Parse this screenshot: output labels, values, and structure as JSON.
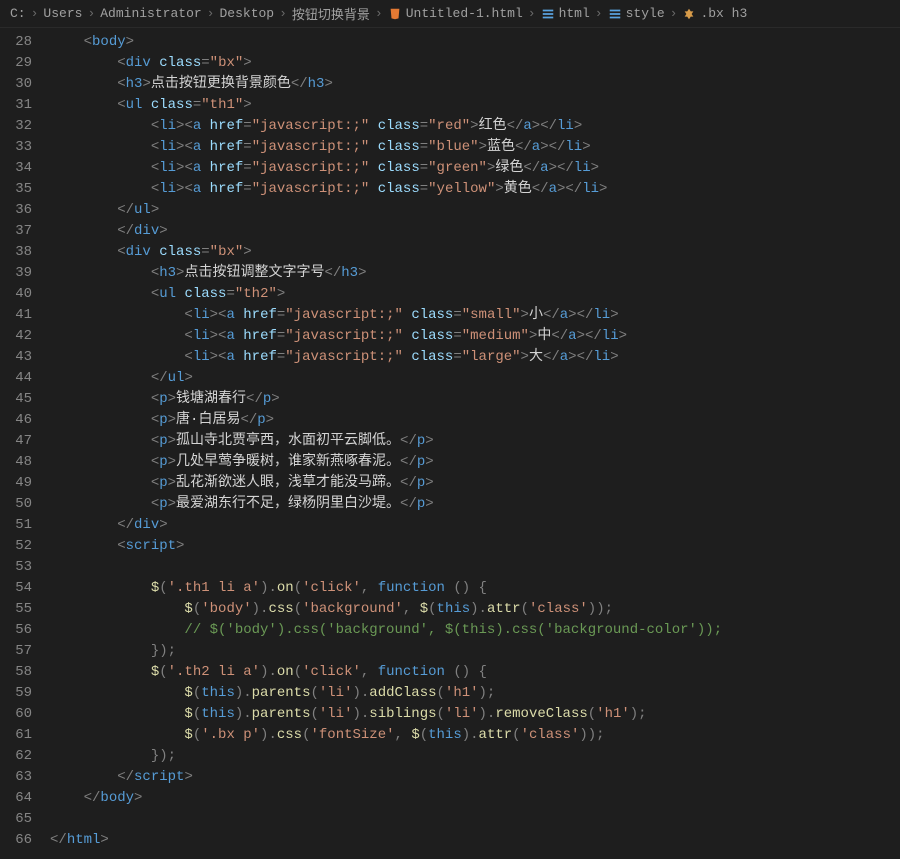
{
  "breadcrumb": [
    {
      "label": "C:",
      "icon": null
    },
    {
      "label": "Users",
      "icon": null
    },
    {
      "label": "Administrator",
      "icon": null
    },
    {
      "label": "Desktop",
      "icon": null
    },
    {
      "label": "按钮切换背景",
      "icon": null
    },
    {
      "label": "Untitled-1.html",
      "icon": "file-html"
    },
    {
      "label": "html",
      "icon": "symbol-struct"
    },
    {
      "label": "style",
      "icon": "symbol-struct"
    },
    {
      "label": ".bx h3",
      "icon": "symbol-class"
    }
  ],
  "gutter_start": 28,
  "gutter_end": 66,
  "code": {
    "l28": {
      "tag": "body"
    },
    "l29": {
      "tag": "div",
      "attr": "class",
      "val": "bx"
    },
    "l30": {
      "tag": "h3",
      "text": "点击按钮更换背景颜色"
    },
    "l31": {
      "tag": "ul",
      "attr": "class",
      "val": "th1"
    },
    "l32": {
      "href": "javascript:;",
      "cls": "red",
      "text": "红色"
    },
    "l33": {
      "href": "javascript:;",
      "cls": "blue",
      "text": "蓝色"
    },
    "l34": {
      "href": "javascript:;",
      "cls": "green",
      "text": "绿色"
    },
    "l35": {
      "href": "javascript:;",
      "cls": "yellow",
      "text": "黄色"
    },
    "l38": {
      "tag": "div",
      "attr": "class",
      "val": "bx"
    },
    "l39": {
      "tag": "h3",
      "text": "点击按钮调整文字字号"
    },
    "l40": {
      "tag": "ul",
      "attr": "class",
      "val": "th2"
    },
    "l41": {
      "href": "javascript:;",
      "cls": "small",
      "text": "小"
    },
    "l42": {
      "href": "javascript:;",
      "cls": "medium",
      "text": "中"
    },
    "l43": {
      "href": "javascript:;",
      "cls": "large",
      "text": "大"
    },
    "l45": {
      "text": "钱塘湖春行"
    },
    "l46": {
      "text": "唐·白居易"
    },
    "l47": {
      "text": "孤山寺北贾亭西，水面初平云脚低。"
    },
    "l48": {
      "text": "几处早莺争暖树，谁家新燕啄春泥。"
    },
    "l49": {
      "text": "乱花渐欲迷人眼，浅草才能没马蹄。"
    },
    "l50": {
      "text": "最爱湖东行不足，绿杨阴里白沙堤。"
    },
    "l54": {
      "sel": "'.th1 li a'",
      "evt": "'click'"
    },
    "l55": {
      "body_sel": "'body'",
      "prop": "'background'",
      "attrArg": "'class'"
    },
    "l56": {
      "comment": "// $('body').css('background', $(this).css('background-color'));"
    },
    "l58": {
      "sel": "'.th2 li a'",
      "evt": "'click'"
    },
    "l59": {
      "par": "'li'",
      "cls": "'h1'"
    },
    "l60": {
      "par": "'li'",
      "sib": "'li'",
      "cls": "'h1'"
    },
    "l61": {
      "sel": "'.bx p'",
      "prop": "'fontSize'",
      "attrArg": "'class'"
    }
  }
}
